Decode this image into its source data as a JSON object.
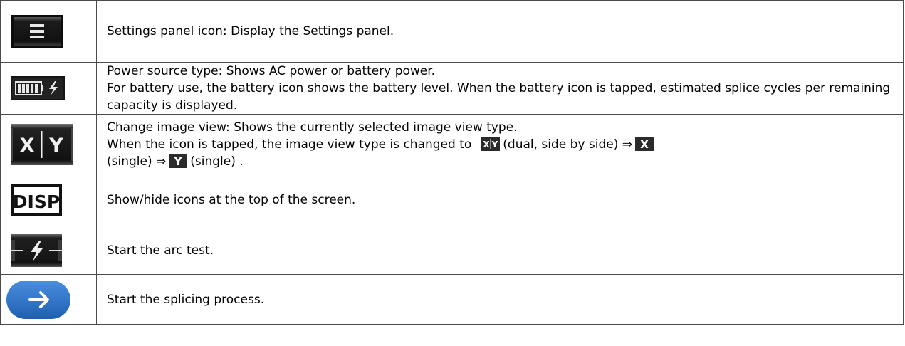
{
  "rows": [
    {
      "icon": "menu-icon",
      "lines": [
        "Settings panel icon: Display the Settings panel."
      ]
    },
    {
      "icon": "battery-icon",
      "lines": [
        "Power source type: Shows AC power or battery power.",
        "For battery use, the battery icon shows the battery level. When the battery icon is tapped, estimated splice cycles per remaining capacity is displayed."
      ]
    },
    {
      "icon": "xy-view-icon",
      "lines": [
        "Change image view: Shows the currently selected image view type.",
        "When the icon is tapped, the image view type is changed to",
        "(dual, side by side) ⇒",
        "(single) ⇒",
        "(single) ."
      ],
      "inline_icons": [
        "xy-icon",
        "x-icon",
        "y-icon"
      ],
      "glyphs": {
        "x": "X",
        "y": "Y"
      }
    },
    {
      "icon": "disp-icon",
      "icon_text": "DISP",
      "lines": [
        "Show/hide icons at the top of the screen."
      ]
    },
    {
      "icon": "arc-test-icon",
      "lines": [
        "Start the arc test."
      ]
    },
    {
      "icon": "arrow-right-icon",
      "lines": [
        "Start the splicing process."
      ]
    }
  ],
  "colors": {
    "border": "#4a4a4a",
    "icon_dark": "#1a1a1a",
    "splice_blue": "#2a72c8",
    "inline_green": "#3b8a3b"
  }
}
